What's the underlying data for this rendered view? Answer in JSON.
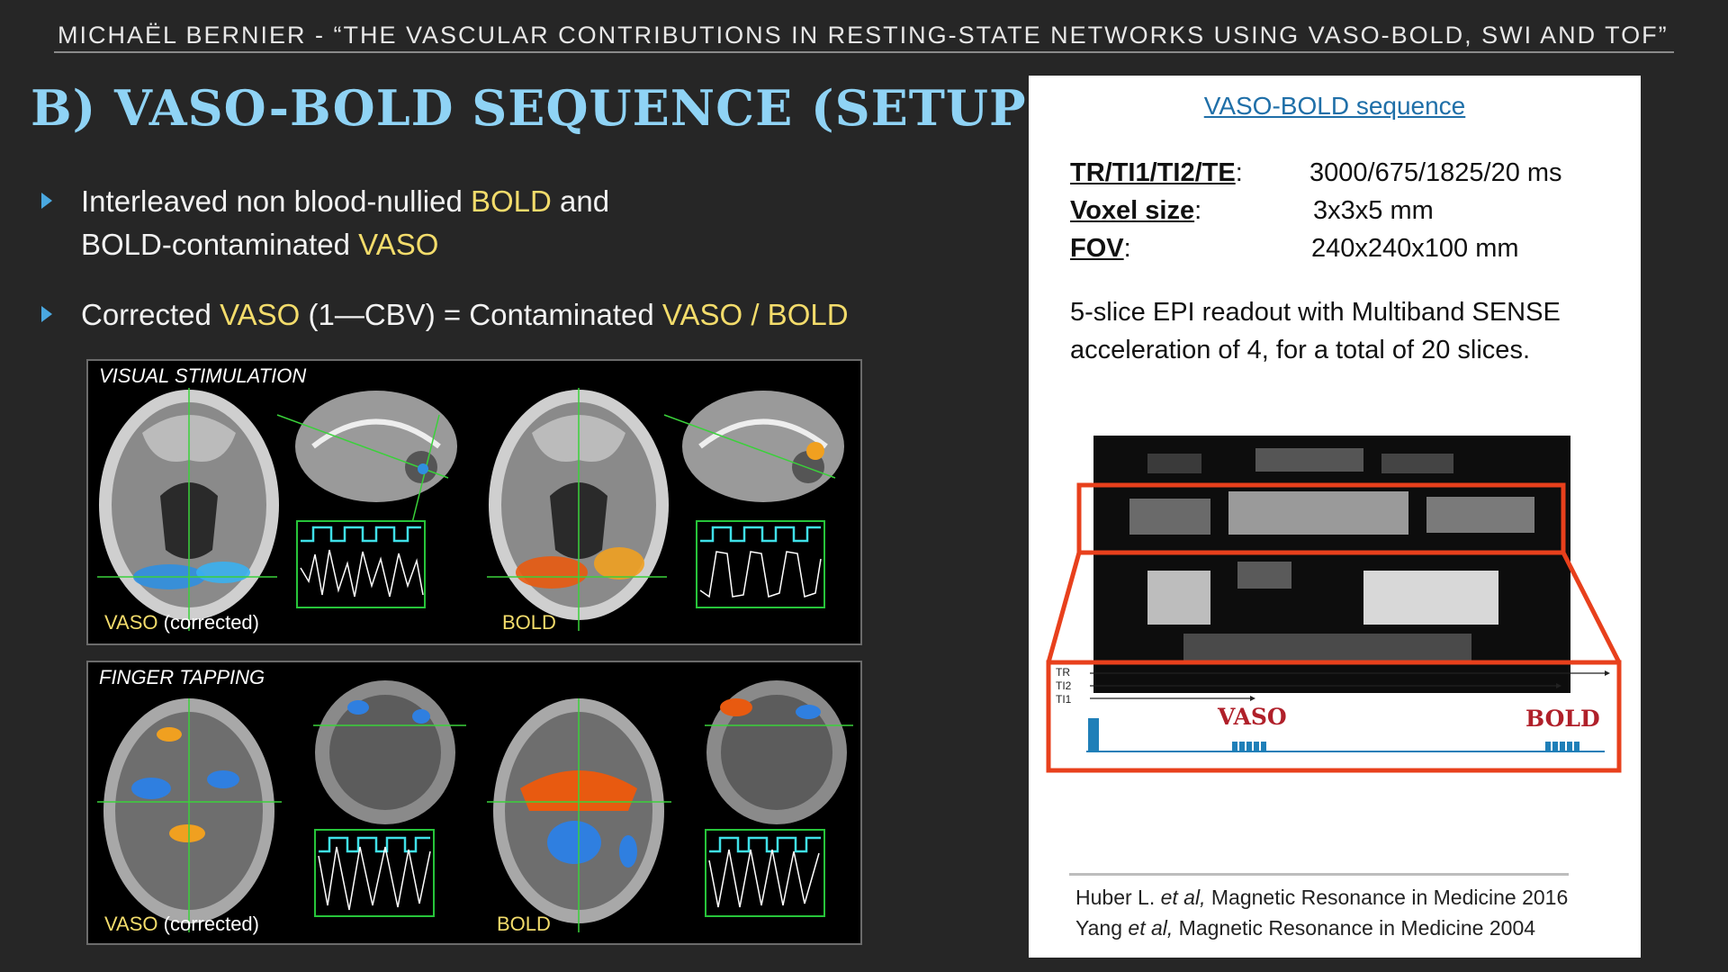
{
  "header": {
    "text": "MICHAËL BERNIER   -  “THE VASCULAR CONTRIBUTIONS IN RESTING-STATE NETWORKS USING VASO-BOLD, SWI AND TOF”"
  },
  "slide_title": "B) VASO-BOLD SEQUENCE (SETUP)",
  "bullets": [
    {
      "parts": [
        "Interleaved non blood-nullied ",
        "BOLD",
        " and BOLD-contaminated ",
        "VASO"
      ]
    },
    {
      "parts": [
        "Corrected ",
        "VASO",
        " (1—CBV) = Contaminated ",
        "VASO / BOLD"
      ]
    }
  ],
  "panels": {
    "visual": {
      "label": "VISUAL STIMULATION",
      "left_caption_hl": "VASO",
      "left_caption_rest": " (corrected)",
      "right_caption": "BOLD"
    },
    "finger": {
      "label": "FINGER TAPPING",
      "left_caption_hl": "VASO",
      "left_caption_rest": " (corrected)",
      "right_caption": "BOLD"
    }
  },
  "sequence_box": {
    "title": "VASO-BOLD sequence",
    "params": [
      {
        "key": "TR/TI1/TI2/TE",
        "sep": ":",
        "value": "3000/675/1825/20 ms"
      },
      {
        "key": "Voxel size",
        "sep": ":",
        "value": "3x3x5 mm"
      },
      {
        "key": "FOV",
        "sep": ":",
        "value": "240x240x100 mm"
      }
    ],
    "description": "5-slice EPI readout with Multiband SENSE acceleration of 4, for a total of 20 slices.",
    "timing": {
      "labels": [
        "TR",
        "TI2",
        "TI1"
      ],
      "vaso_label": "VASO",
      "bold_label": "BOLD"
    },
    "references": [
      {
        "author": "Huber L. ",
        "etal": "et al,",
        "journal": " Magnetic Resonance in Medicine 2016"
      },
      {
        "author": "Yang ",
        "etal": "et al,",
        "journal": " Magnetic Resonance in Medicine 2004"
      }
    ]
  },
  "colors": {
    "title": "#8fd3f5",
    "highlight": "#f3dc6b",
    "bullet_arrow": "#4aa8e0",
    "zoom_frame": "#e8401c",
    "vaso_bold_label": "#b0202a",
    "signal_cyan": "#3fe0e8",
    "plot_frame": "#27c43a"
  },
  "icons": [
    "triangle-bullet-icon",
    "triangle-bullet-icon"
  ]
}
